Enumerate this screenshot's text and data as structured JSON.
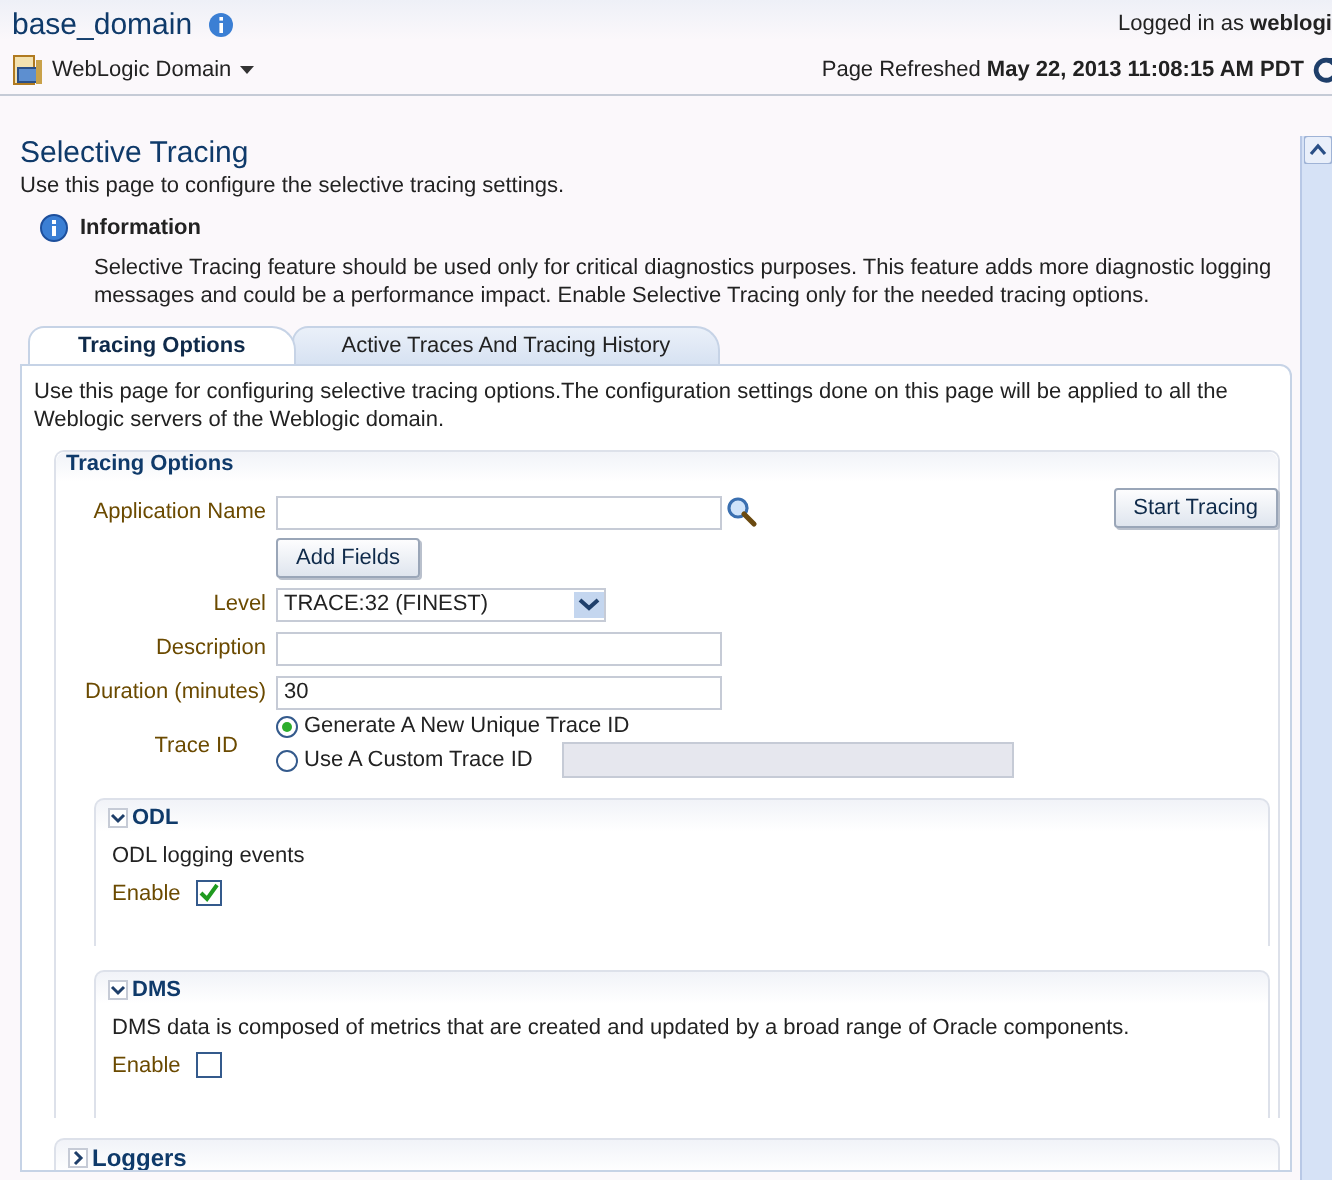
{
  "header": {
    "title": "base_domain",
    "user_label": "Logged in as",
    "user": "weblogi",
    "menu": "WebLogic Domain",
    "refreshed_label": "Page Refreshed",
    "refreshed": "May 22, 2013 11:08:15 AM PDT"
  },
  "page": {
    "title": "Selective Tracing",
    "description": "Use this page to configure the selective tracing settings."
  },
  "information": {
    "title": "Information",
    "text": "Selective Tracing feature should be used only for critical diagnostics purposes. This feature adds more diagnostic logging messages and could be a performance impact. Enable Selective Tracing only for the needed tracing options."
  },
  "tabs": [
    {
      "label": "Tracing Options",
      "selected": true
    },
    {
      "label": "Active Traces And Tracing History",
      "selected": false
    }
  ],
  "tab_description": "Use this page for configuring selective tracing options.The configuration settings done on this page will be applied to all the Weblogic servers of the Weblogic domain.",
  "tracing_options": {
    "title": "Tracing Options",
    "start_button": "Start Tracing",
    "fields": [
      {
        "kind": "search",
        "label": "Application Name"
      },
      {
        "kind": "button",
        "label": "Add Fields"
      },
      {
        "kind": "select",
        "label": "Level",
        "value": "TRACE:32 (FINEST)"
      },
      {
        "kind": "text",
        "label": "Description"
      },
      {
        "kind": "text",
        "label": "Duration (minutes)",
        "value": "30"
      },
      {
        "kind": "radio",
        "label": "Trace ID",
        "options": [
          {
            "label": "Generate A New Unique Trace ID",
            "selected": true
          },
          {
            "label": "Use A Custom Trace ID",
            "selected": false,
            "input_disabled": true
          }
        ]
      }
    ]
  },
  "sections": [
    {
      "title": "ODL",
      "expanded": true,
      "description": "ODL logging events",
      "enable_label": "Enable",
      "checked": true
    },
    {
      "title": "DMS",
      "expanded": true,
      "description": "DMS data is composed of metrics that are created and updated by a broad range of Oracle components.",
      "enable_label": "Enable",
      "checked": false
    }
  ],
  "loggers": {
    "title": "Loggers",
    "expanded": false
  }
}
